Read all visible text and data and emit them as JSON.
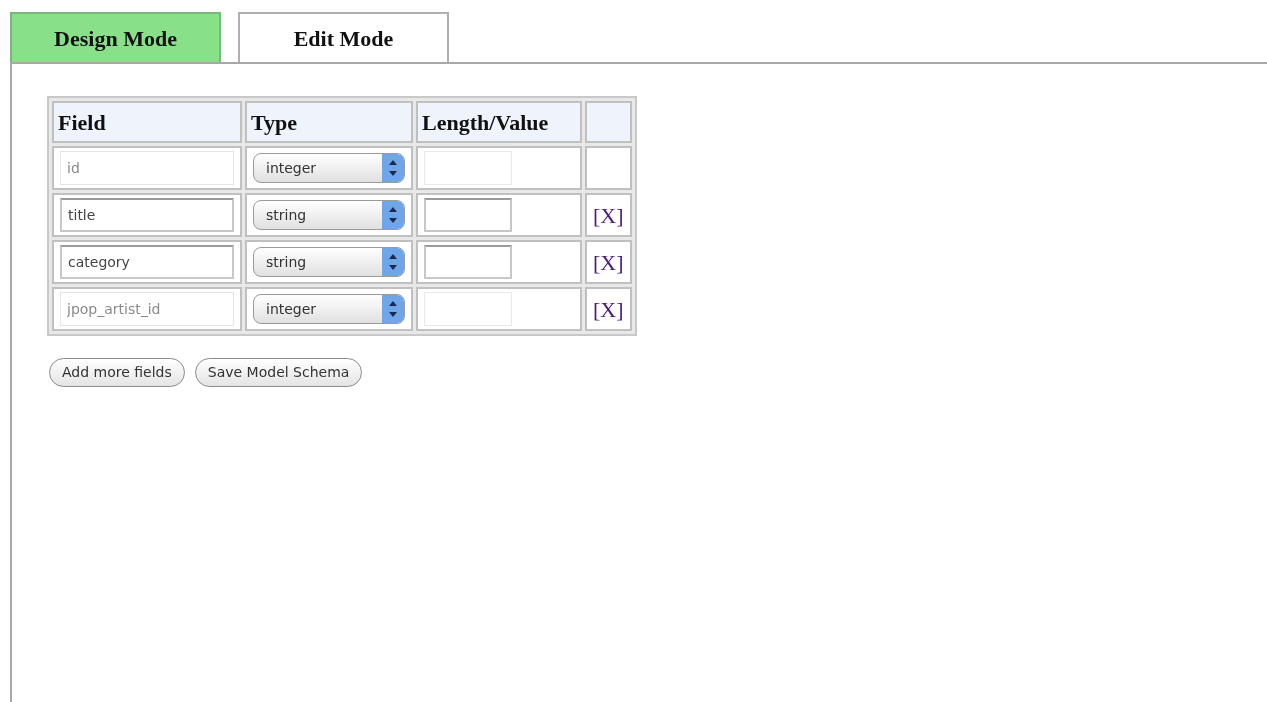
{
  "tabs": [
    {
      "label": "Design Mode",
      "selected": true
    },
    {
      "label": "Edit Mode",
      "selected": false
    }
  ],
  "table": {
    "columns": [
      "Field",
      "Type",
      "Length/Value",
      ""
    ],
    "rows": [
      {
        "field": "id",
        "type": "integer",
        "disabled": true
      },
      {
        "field": "title",
        "type": "string",
        "disabled": false,
        "remove": "[X]"
      },
      {
        "field": "category",
        "type": "string",
        "disabled": false,
        "remove": "[X]"
      },
      {
        "field": "jpop_artist_id",
        "type": "integer",
        "disabled": true,
        "remove": "[X]"
      }
    ]
  },
  "buttons": [
    "Add more fields",
    "Save Model Schema"
  ]
}
